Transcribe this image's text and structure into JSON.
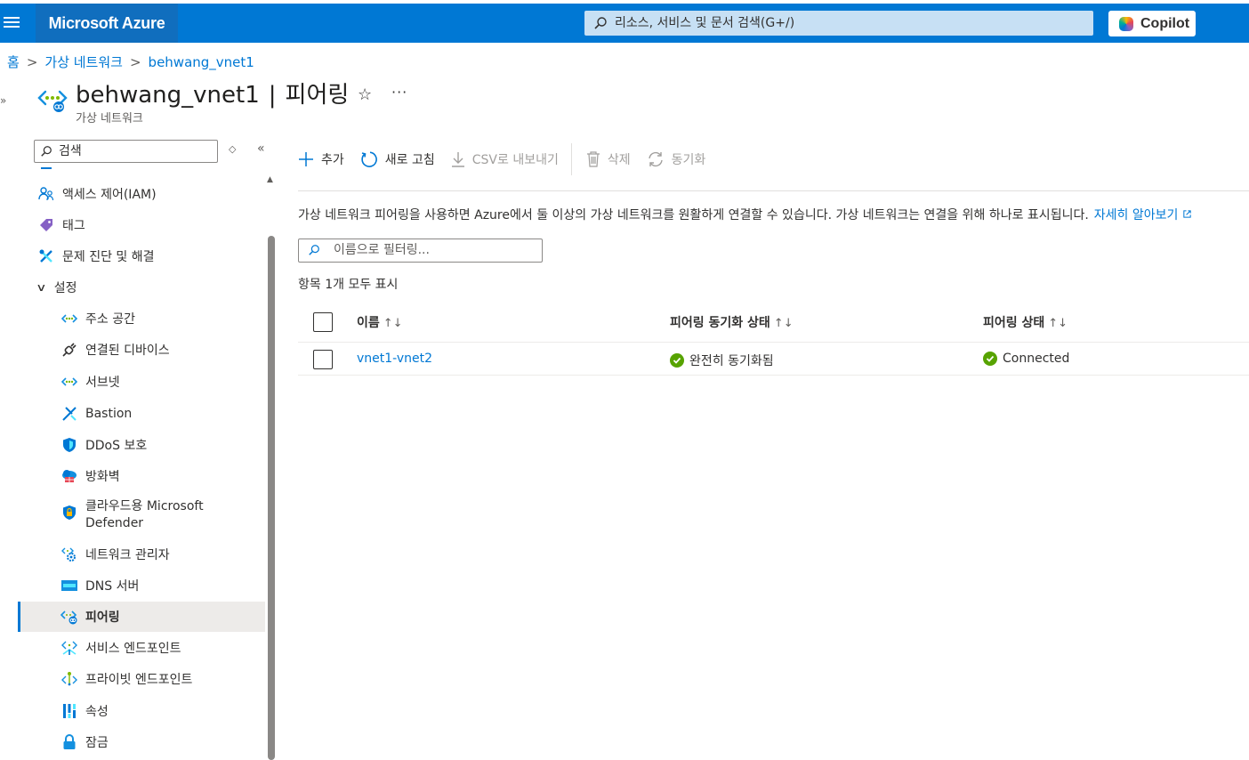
{
  "topbar": {
    "brand": "Microsoft Azure",
    "search_placeholder": "리소스, 서비스 및 문서 검색(G+/)",
    "copilot_label": "Copilot",
    "accent_color": "#0078d4"
  },
  "breadcrumb": {
    "items": [
      "홈",
      "가상 네트워크",
      "behwang_vnet1"
    ],
    "separator": ">"
  },
  "header": {
    "resource_name": "behwang_vnet1",
    "divider": "|",
    "blade_name": "피어링",
    "subtitle": "가상 네트워크",
    "favorite_icon": "star-icon",
    "more_label": "···"
  },
  "sidebar": {
    "search_placeholder": "검색",
    "items": [
      {
        "label": "액세스 제어(IAM)",
        "icon": "people-icon"
      },
      {
        "label": "태그",
        "icon": "tag-icon"
      },
      {
        "label": "문제 진단 및 해결",
        "icon": "wrench-icon"
      },
      {
        "label": "설정",
        "icon": "chevron-down-icon"
      },
      {
        "label": "주소 공간",
        "icon": "vnet-icon"
      },
      {
        "label": "연결된 디바이스",
        "icon": "plug-icon"
      },
      {
        "label": "서브넷",
        "icon": "vnet-icon"
      },
      {
        "label": "Bastion",
        "icon": "bastion-icon"
      },
      {
        "label": "DDoS 보호",
        "icon": "shield-icon"
      },
      {
        "label": "방화벽",
        "icon": "firewall-icon"
      },
      {
        "label": "클라우드용 Microsoft Defender",
        "icon": "defender-icon"
      },
      {
        "label": "네트워크 관리자",
        "icon": "network-manager-icon"
      },
      {
        "label": "DNS 서버",
        "icon": "dns-icon"
      },
      {
        "label": "피어링",
        "icon": "peering-icon"
      },
      {
        "label": "서비스 엔드포인트",
        "icon": "service-endpoint-icon"
      },
      {
        "label": "프라이빗 엔드포인트",
        "icon": "private-endpoint-icon"
      },
      {
        "label": "속성",
        "icon": "properties-icon"
      },
      {
        "label": "잠금",
        "icon": "lock-icon"
      }
    ]
  },
  "toolbar": {
    "add": "추가",
    "refresh": "새로 고침",
    "export_csv": "CSV로 내보내기",
    "delete": "삭제",
    "sync": "동기화"
  },
  "main": {
    "description": "가상 네트워크 피어링을 사용하면 Azure에서 둘 이상의 가상 네트워크를 원활하게 연결할 수 있습니다. 가상 네트워크는 연결을 위해 하나로 표시됩니다.",
    "learn_more": "자세히 알아보기",
    "filter_placeholder": "이름으로 필터링...",
    "count_text": "항목 1개 모두 표시"
  },
  "table": {
    "columns": [
      "이름",
      "피어링 동기화 상태",
      "피어링 상태"
    ],
    "sort_glyph": "↑↓",
    "rows": [
      {
        "name": "vnet1-vnet2",
        "sync_status": "완전히 동기화됨",
        "peering_status": "Connected"
      }
    ],
    "status_color": "#57a300"
  }
}
